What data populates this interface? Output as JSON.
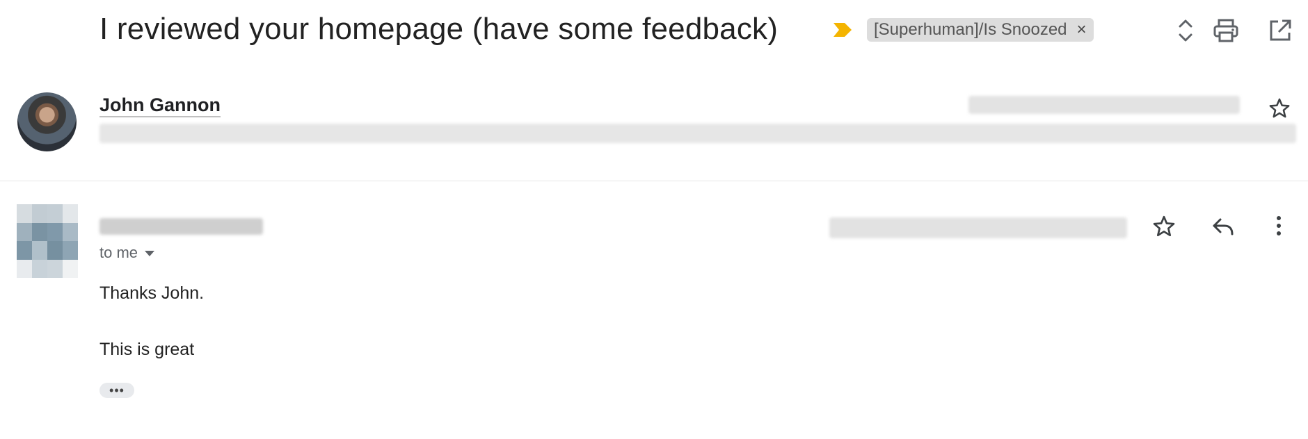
{
  "thread": {
    "subject": "I reviewed your homepage (have some feedback)",
    "label_chip": {
      "text": "[Superhuman]/Is Snoozed",
      "remove_glyph": "×"
    },
    "toolbar_icons": [
      "expand-collapse-icon",
      "print-icon",
      "open-in-new-window-icon"
    ],
    "important_color": "#f4b400"
  },
  "first_message": {
    "sender_name": "John Gannon",
    "avatar": "profile-photo",
    "star_icon": "star-outline-icon"
  },
  "second_message": {
    "avatar": "pixelated-avatar",
    "recipient_label": "to me",
    "body_lines": [
      "Thanks John.",
      "This is great"
    ],
    "trimmed_content_glyph": "•••",
    "action_icons": [
      "star-outline-icon",
      "reply-icon",
      "more-vert-icon"
    ]
  }
}
